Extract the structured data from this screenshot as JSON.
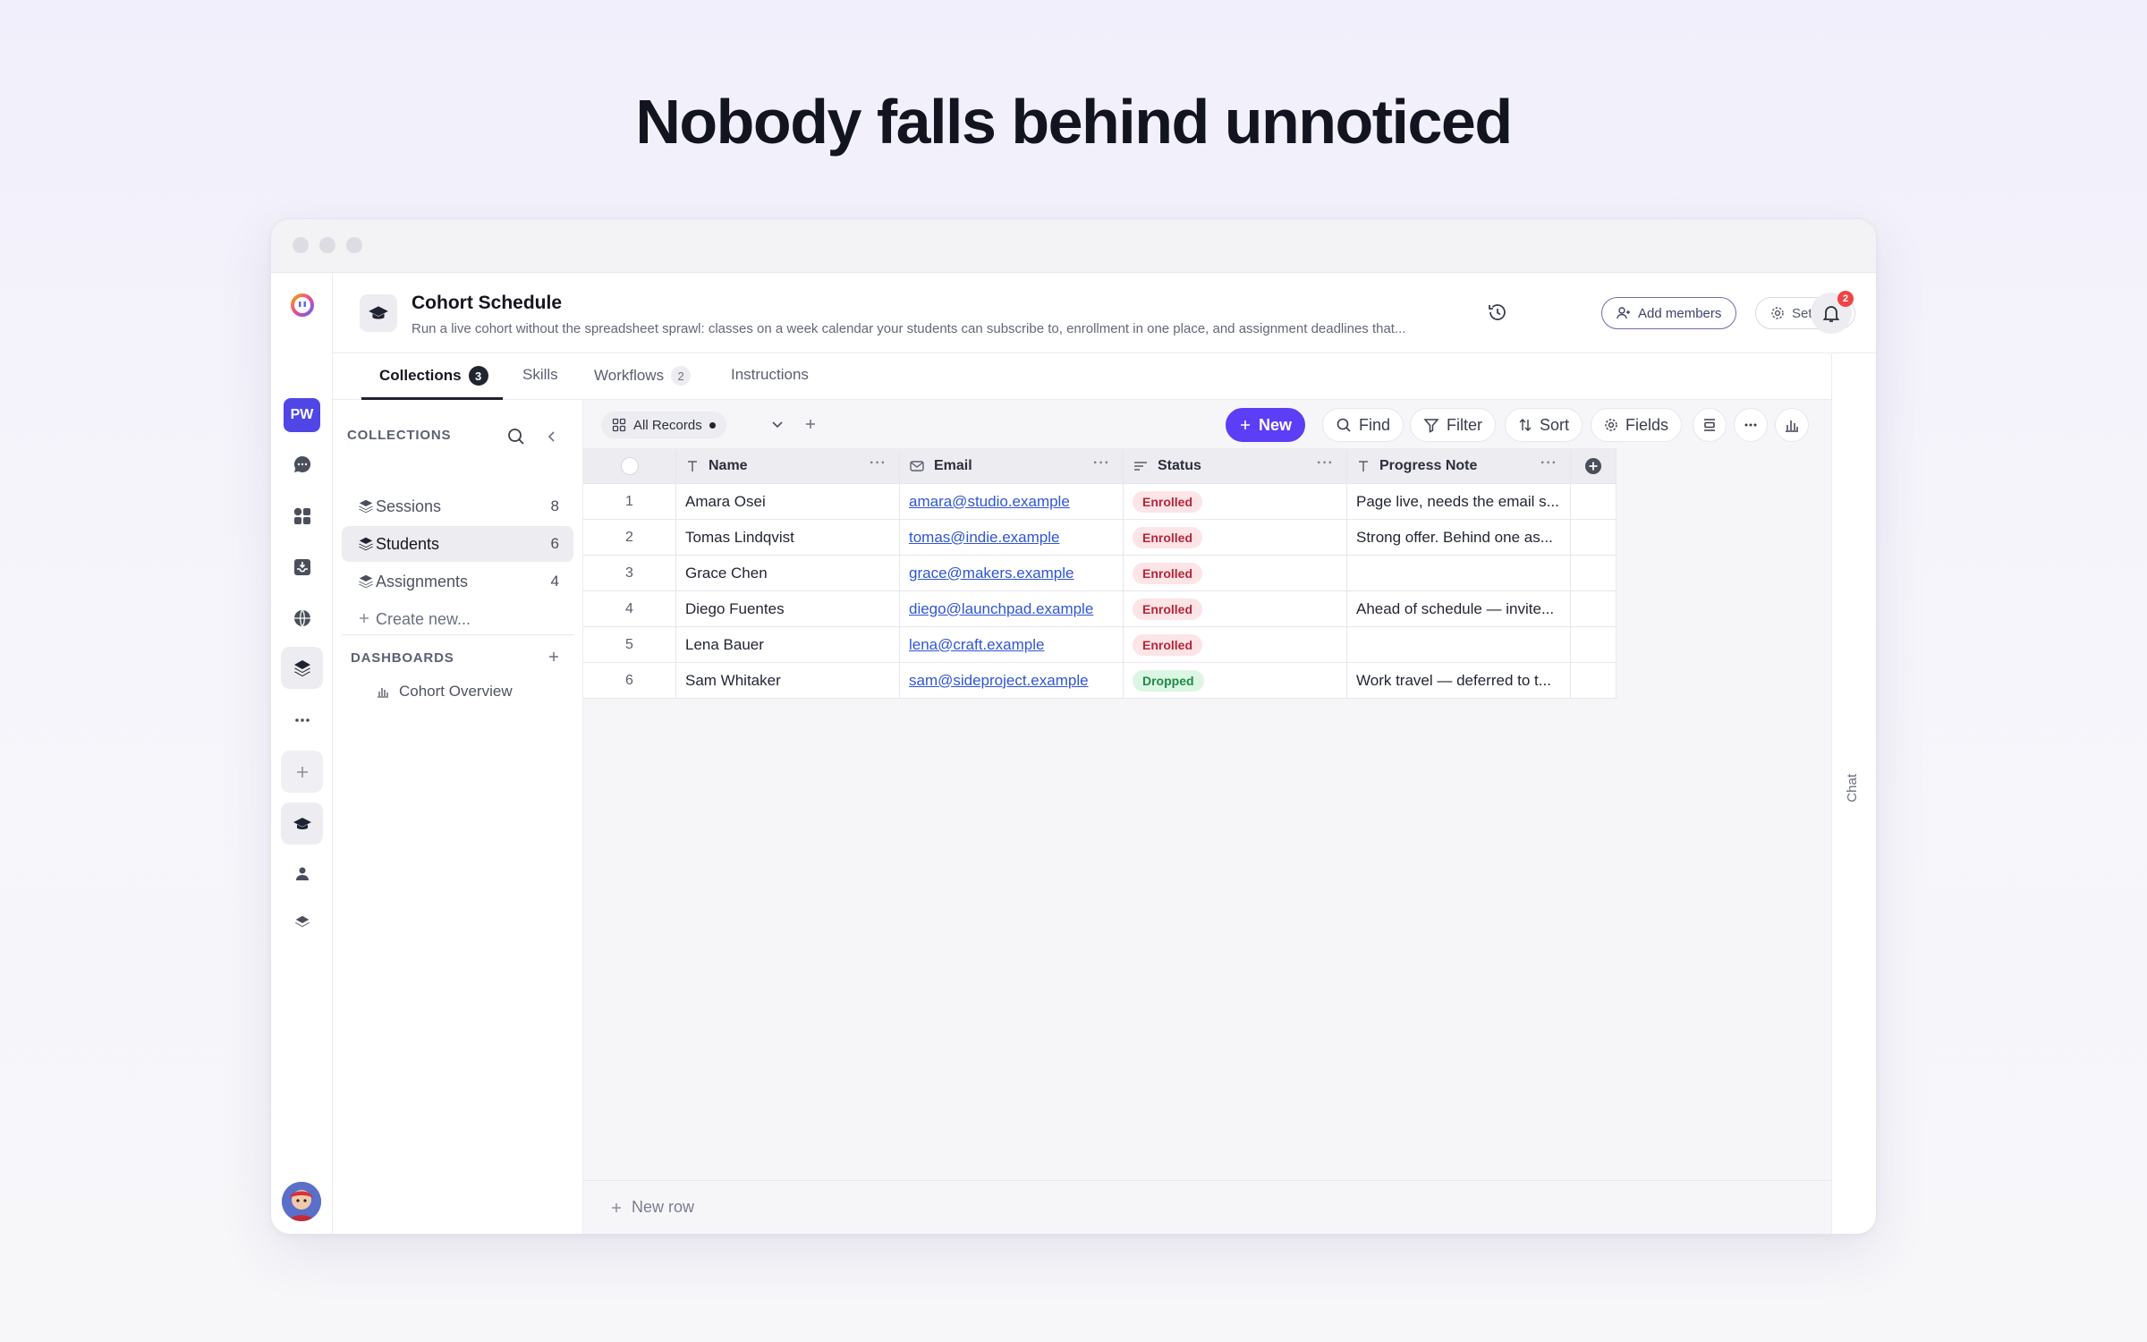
{
  "hero": {
    "title": "Nobody falls behind unnoticed"
  },
  "rail": {
    "workspace_initials": "PW"
  },
  "header": {
    "title": "Cohort Schedule",
    "description": "Run a live cohort without the spreadsheet sprawl: classes on a week calendar your students can subscribe to, enrollment in one place, and assignment deadlines that...",
    "add_members_label": "Add members",
    "settings_label": "Settings",
    "notification_count": "2"
  },
  "tabs": [
    {
      "label": "Collections",
      "count": "3"
    },
    {
      "label": "Skills"
    },
    {
      "label": "Workflows",
      "count": "2"
    },
    {
      "label": "Instructions"
    }
  ],
  "sidebar": {
    "collections_heading": "COLLECTIONS",
    "items": [
      {
        "label": "Sessions",
        "count": "8"
      },
      {
        "label": "Students",
        "count": "6"
      },
      {
        "label": "Assignments",
        "count": "4"
      }
    ],
    "create_new": "Create new...",
    "dashboards_heading": "DASHBOARDS",
    "dashboards": [
      {
        "label": "Cohort Overview"
      }
    ]
  },
  "toolbar": {
    "view_label": "All Records",
    "new_label": "New",
    "find_label": "Find",
    "filter_label": "Filter",
    "sort_label": "Sort",
    "fields_label": "Fields"
  },
  "table": {
    "columns": [
      "Name",
      "Email",
      "Status",
      "Progress Note"
    ],
    "rows": [
      {
        "num": "1",
        "name": "Amara Osei",
        "email": "amara@studio.example",
        "status": "Enrolled",
        "note": "Page live, needs the email s..."
      },
      {
        "num": "2",
        "name": "Tomas Lindqvist",
        "email": "tomas@indie.example",
        "status": "Enrolled",
        "note": "Strong offer. Behind one as..."
      },
      {
        "num": "3",
        "name": "Grace Chen",
        "email": "grace@makers.example",
        "status": "Enrolled",
        "note": ""
      },
      {
        "num": "4",
        "name": "Diego Fuentes",
        "email": "diego@launchpad.example",
        "status": "Enrolled",
        "note": "Ahead of schedule — invite..."
      },
      {
        "num": "5",
        "name": "Lena Bauer",
        "email": "lena@craft.example",
        "status": "Enrolled",
        "note": ""
      },
      {
        "num": "6",
        "name": "Sam Whitaker",
        "email": "sam@sideproject.example",
        "status": "Dropped",
        "note": "Work travel — deferred to t..."
      }
    ],
    "new_row_label": "New row"
  },
  "chat": {
    "label": "Chat"
  },
  "colors": {
    "accent": "#5b3ef5",
    "enrolled_bg": "#fde4e6",
    "dropped_bg": "#dcf6e4"
  }
}
